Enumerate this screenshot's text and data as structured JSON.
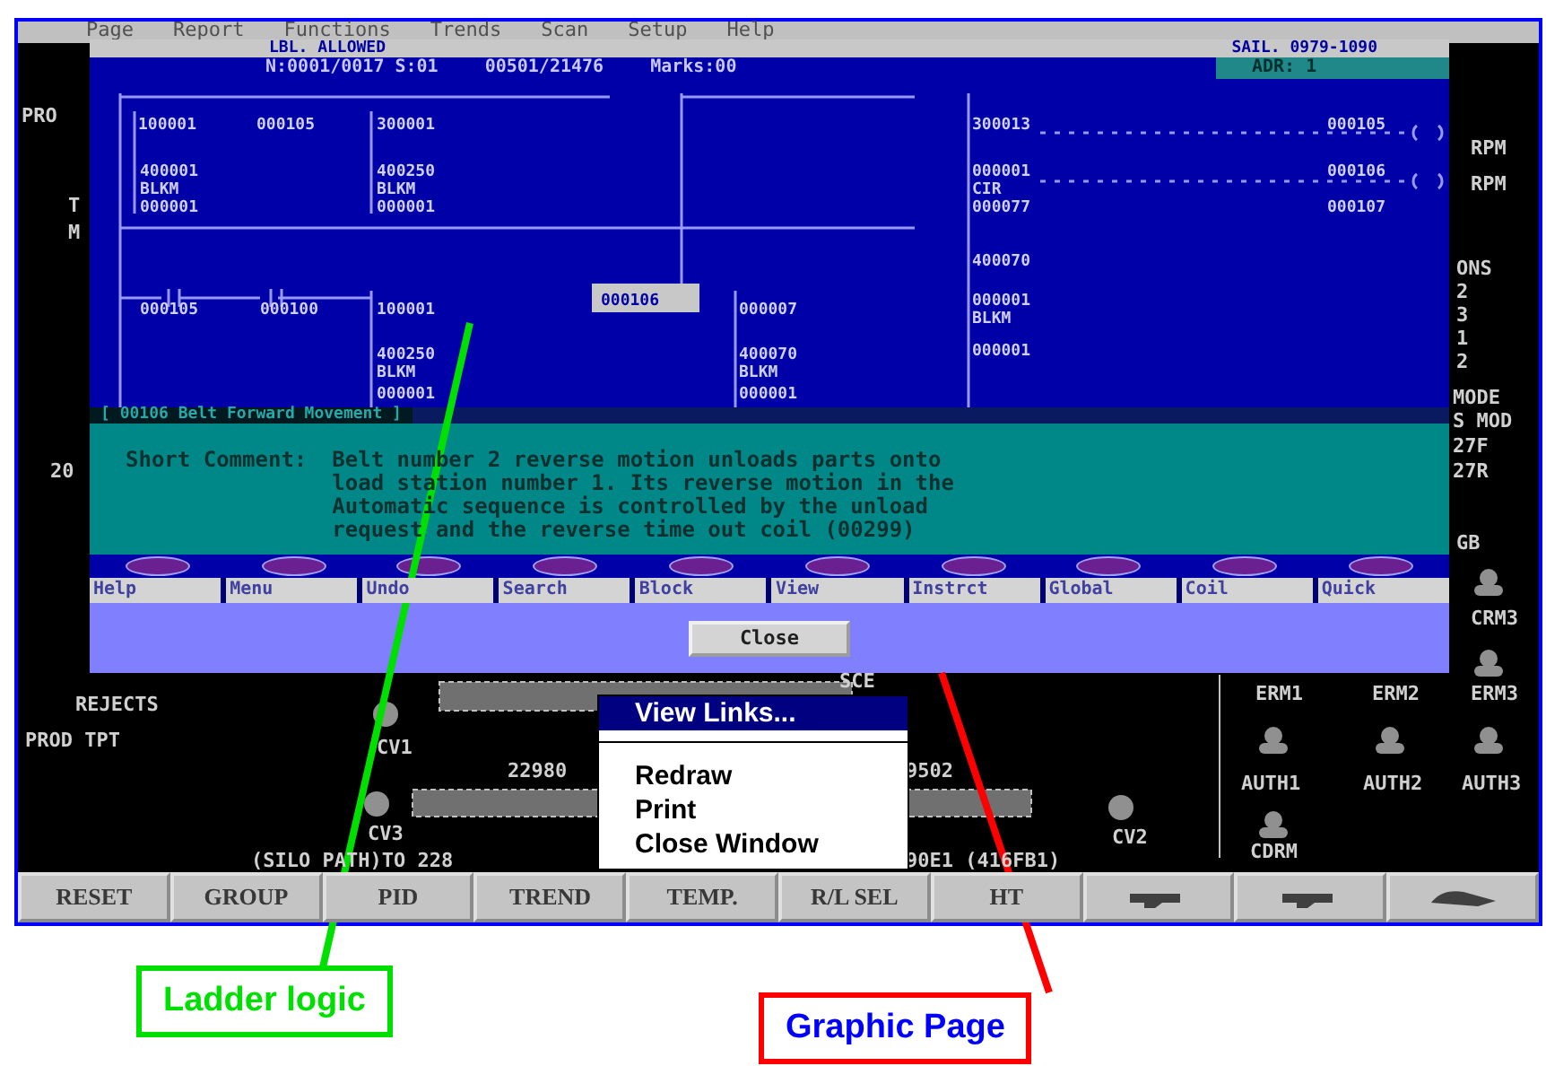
{
  "menu_bar": [
    "Page",
    "Report",
    "Functions",
    "Trends",
    "Scan",
    "Setup",
    "Help"
  ],
  "ladder_window": {
    "header_left": "LBL. ALLOWED",
    "header_right": "SAIL. 0979-1090",
    "node": "N:0001/0017 S:01",
    "position": "00501/21476",
    "marks": "Marks:00",
    "address": "ADR: 1",
    "labels": [
      {
        "text": "100001",
        "selected": false
      },
      {
        "text": "000105",
        "selected": false
      },
      {
        "text": "300001",
        "selected": false
      },
      {
        "text": "400001",
        "selected": false
      },
      {
        "text": "BLKM",
        "selected": false
      },
      {
        "text": "000001",
        "selected": false
      },
      {
        "text": "400250",
        "selected": false
      },
      {
        "text": "BLKM",
        "selected": false
      },
      {
        "text": "000001",
        "selected": false
      },
      {
        "text": "300013",
        "selected": false
      },
      {
        "text": "000001",
        "selected": false
      },
      {
        "text": "CIR",
        "selected": false
      },
      {
        "text": "000077",
        "selected": false
      },
      {
        "text": "000105",
        "selected": false
      },
      {
        "text": "000106",
        "selected": false
      },
      {
        "text": "000107",
        "selected": false
      },
      {
        "text": "000105",
        "selected": false
      },
      {
        "text": "000100",
        "selected": false
      },
      {
        "text": "100001",
        "selected": false
      },
      {
        "text": "400250",
        "selected": false
      },
      {
        "text": "BLKM",
        "selected": false
      },
      {
        "text": "000001",
        "selected": false
      },
      {
        "text": "000106",
        "selected": true
      },
      {
        "text": "000007",
        "selected": false
      },
      {
        "text": "400070",
        "selected": false
      },
      {
        "text": "BLKM",
        "selected": false
      },
      {
        "text": "000001",
        "selected": false
      },
      {
        "text": "400070",
        "selected": false
      },
      {
        "text": "000001",
        "selected": false
      },
      {
        "text": "BLKM",
        "selected": false
      },
      {
        "text": "000001",
        "selected": false
      }
    ],
    "rung_title": "[ 00106 Belt Forward Movement ]",
    "comment_label": "Short Comment:",
    "comment": "Belt number 2 reverse motion unloads parts onto\nload station number 1. Its reverse motion in the\nAutomatic sequence is controlled by the unload\nrequest and the reverse time out coil (00299)",
    "buttons": [
      "Help",
      "Menu",
      "Undo",
      "Search",
      "Block",
      "View",
      "Instrct",
      "Global",
      "Coil",
      "Quick"
    ],
    "close_button": "Close"
  },
  "plant_labels": [
    "PRO",
    "T",
    "M",
    "20",
    "REJECTS",
    "PROD TPT",
    "CV1",
    "22980",
    "SCE",
    "9502",
    "CV3",
    "CV2",
    "(SILO PATH)TO 228",
    "90E1 (416FB1)",
    "RPM",
    "RPM",
    "ONS",
    "2",
    "3",
    "1",
    "2",
    "MODE",
    "S MOD",
    "27F",
    "27R",
    "GB",
    "CRM3",
    "ERM1",
    "ERM2",
    "ERM3",
    "AUTH1",
    "AUTH2",
    "AUTH3",
    "CDRM"
  ],
  "context_menu": [
    {
      "label": "View Links...",
      "selected": true
    },
    {
      "label": "Redraw",
      "selected": false
    },
    {
      "label": "Print",
      "selected": false
    },
    {
      "label": "Close Window",
      "selected": false
    }
  ],
  "toolbar": [
    "RESET",
    "GROUP",
    "PID",
    "TREND",
    "TEMP.",
    "R/L SEL",
    "HT"
  ],
  "annotations": [
    {
      "text": "Ladder logic",
      "color": "#00e000"
    },
    {
      "text": "Graphic Page",
      "color": "#ff0000"
    }
  ]
}
